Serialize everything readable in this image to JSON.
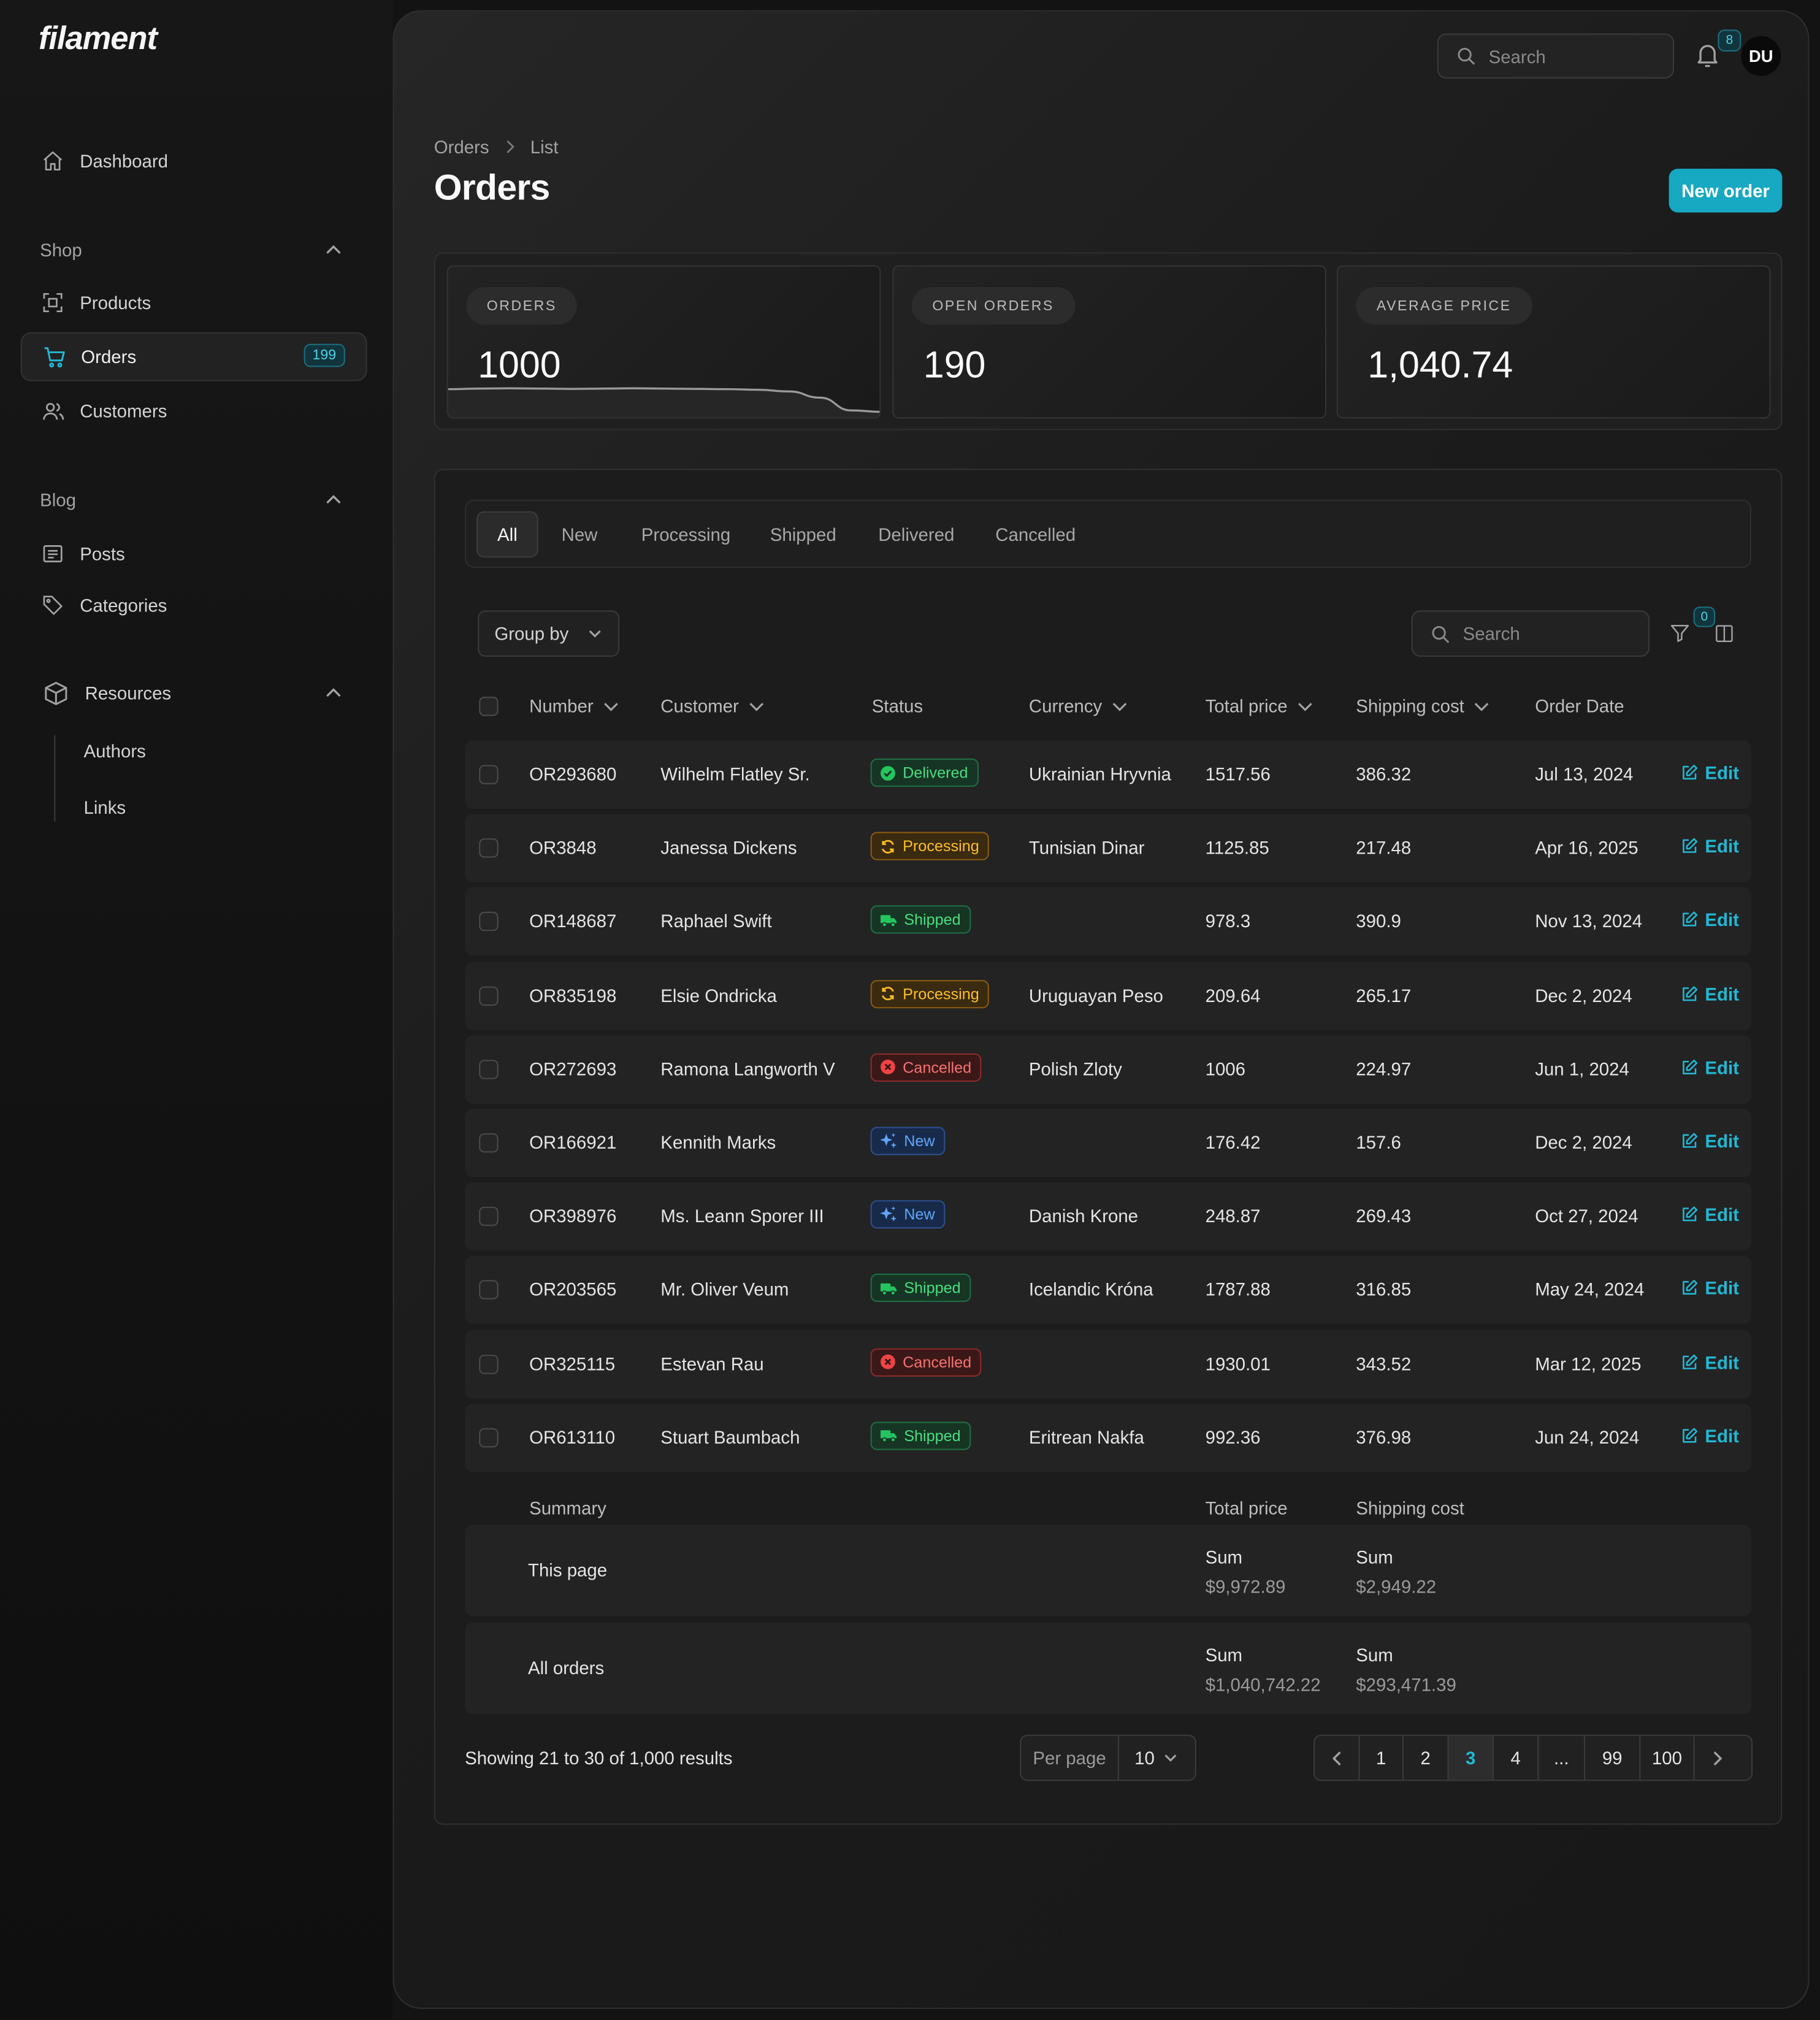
{
  "app": {
    "logo": "filament"
  },
  "sidebar": {
    "dashboard": "Dashboard",
    "shop_label": "Shop",
    "products": "Products",
    "orders": "Orders",
    "orders_badge": "199",
    "customers": "Customers",
    "blog_label": "Blog",
    "posts": "Posts",
    "categories": "Categories",
    "resources_label": "Resources",
    "authors": "Authors",
    "links": "Links"
  },
  "topbar": {
    "search_placeholder": "Search",
    "notifications_count": "8",
    "avatar_initials": "DU"
  },
  "breadcrumb": {
    "first": "Orders",
    "second": "List"
  },
  "page": {
    "title": "Orders",
    "new_button": "New order"
  },
  "stats": [
    {
      "label": "ORDERS",
      "value": "1000",
      "sparkline": [
        0.9,
        0.92,
        0.93,
        0.92,
        0.91,
        0.92,
        0.93,
        0.92,
        0.91,
        0.9,
        0.88,
        0.82,
        0.6,
        0.15,
        0.1
      ]
    },
    {
      "label": "OPEN ORDERS",
      "value": "190"
    },
    {
      "label": "AVERAGE PRICE",
      "value": "1,040.74"
    }
  ],
  "tabs": [
    "All",
    "New",
    "Processing",
    "Shipped",
    "Delivered",
    "Cancelled"
  ],
  "table": {
    "group_by": "Group by",
    "search_placeholder": "Search",
    "filter_count": "0",
    "columns": {
      "number": "Number",
      "customer": "Customer",
      "status": "Status",
      "currency": "Currency",
      "total": "Total price",
      "shipping": "Shipping cost",
      "date": "Order Date"
    },
    "edit_label": "Edit",
    "rows": [
      {
        "number": "OR293680",
        "customer": "Wilhelm Flatley Sr.",
        "status": "Delivered",
        "status_key": "delivered",
        "currency": "Ukrainian Hryvnia",
        "total": "1517.56",
        "shipping": "386.32",
        "date": "Jul 13, 2024"
      },
      {
        "number": "OR3848",
        "customer": "Janessa Dickens",
        "status": "Processing",
        "status_key": "processing",
        "currency": "Tunisian Dinar",
        "total": "1125.85",
        "shipping": "217.48",
        "date": "Apr 16, 2025"
      },
      {
        "number": "OR148687",
        "customer": "Raphael Swift",
        "status": "Shipped",
        "status_key": "shipped",
        "currency": "",
        "total": "978.3",
        "shipping": "390.9",
        "date": "Nov 13, 2024"
      },
      {
        "number": "OR835198",
        "customer": "Elsie Ondricka",
        "status": "Processing",
        "status_key": "processing",
        "currency": "Uruguayan Peso",
        "total": "209.64",
        "shipping": "265.17",
        "date": "Dec 2, 2024"
      },
      {
        "number": "OR272693",
        "customer": "Ramona Langworth V",
        "status": "Cancelled",
        "status_key": "cancelled",
        "currency": "Polish Zloty",
        "total": "1006",
        "shipping": "224.97",
        "date": "Jun 1, 2024"
      },
      {
        "number": "OR166921",
        "customer": "Kennith Marks",
        "status": "New",
        "status_key": "new",
        "currency": "",
        "total": "176.42",
        "shipping": "157.6",
        "date": "Dec 2, 2024"
      },
      {
        "number": "OR398976",
        "customer": "Ms. Leann Sporer III",
        "status": "New",
        "status_key": "new",
        "currency": "Danish Krone",
        "total": "248.87",
        "shipping": "269.43",
        "date": "Oct 27, 2024"
      },
      {
        "number": "OR203565",
        "customer": "Mr. Oliver Veum",
        "status": "Shipped",
        "status_key": "shipped",
        "currency": "Icelandic Króna",
        "total": "1787.88",
        "shipping": "316.85",
        "date": "May 24, 2024"
      },
      {
        "number": "OR325115",
        "customer": "Estevan Rau",
        "status": "Cancelled",
        "status_key": "cancelled",
        "currency": "",
        "total": "1930.01",
        "shipping": "343.52",
        "date": "Mar 12, 2025"
      },
      {
        "number": "OR613110",
        "customer": "Stuart Baumbach",
        "status": "Shipped",
        "status_key": "shipped",
        "currency": "Eritrean Nakfa",
        "total": "992.36",
        "shipping": "376.98",
        "date": "Jun 24, 2024"
      }
    ],
    "summary": {
      "label": "Summary",
      "total_header": "Total price",
      "shipping_header": "Shipping cost",
      "this_page": {
        "label": "This page",
        "total_key": "Sum",
        "total": "$9,972.89",
        "shipping_key": "Sum",
        "shipping": "$2,949.22"
      },
      "all": {
        "label": "All orders",
        "total_key": "Sum",
        "total": "$1,040,742.22",
        "shipping_key": "Sum",
        "shipping": "$293,471.39"
      }
    },
    "pagination": {
      "showing": "Showing 21 to 30 of 1,000 results",
      "per_page_label": "Per page",
      "per_page_value": "10",
      "pages": [
        "1",
        "2",
        "3",
        "4",
        "...",
        "99",
        "100"
      ],
      "active_page": "3"
    }
  },
  "colors": {
    "accent": "#17a8c2",
    "background": "#131313"
  }
}
